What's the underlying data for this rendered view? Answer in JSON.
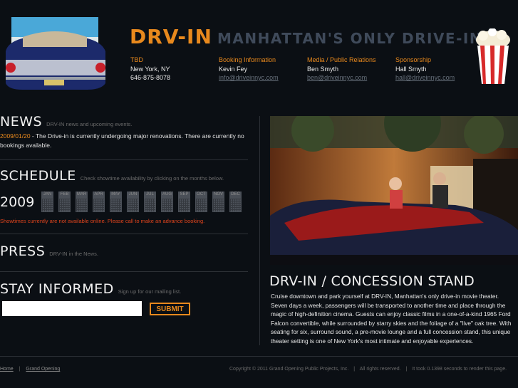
{
  "header": {
    "logo": "DRV-IN",
    "tagline": "MANHATTAN'S ONLY DRIVE-IN",
    "contacts": [
      {
        "label": "TBD",
        "line1": "New York, NY",
        "line2": "646-875-8078"
      },
      {
        "label": "Booking Information",
        "line1": "Kevin Fey",
        "line2": "info@driveinnyc.com"
      },
      {
        "label": "Media / Public Relations",
        "line1": "Ben Smyth",
        "line2": "ben@driveinnyc.com"
      },
      {
        "label": "Sponsorship",
        "line1": "Hall Smyth",
        "line2": "hall@driveinnyc.com"
      }
    ]
  },
  "news": {
    "title": "NEWS",
    "subtitle": "DRV-IN news and upcoming events.",
    "date": "2009/01/20",
    "text": " - The Drive-in is currently undergoing major renovations. There are currently no bookings available."
  },
  "schedule": {
    "title": "SCHEDULE",
    "subtitle": "Check showtime availability by clicking on the months below.",
    "year": "2009",
    "months": [
      "JAN",
      "FEB",
      "MAR",
      "APR",
      "MAY",
      "JUN",
      "JUL",
      "AUG",
      "SEP",
      "OCT",
      "NOV",
      "DEC"
    ],
    "notice": "Showtimes currently are not available online. Please call to make an advance booking."
  },
  "press": {
    "title": "PRESS",
    "subtitle": "DRV-IN in the News."
  },
  "stay": {
    "title": "STAY INFORMED",
    "subtitle": "Sign up for our mailing list.",
    "email_value": "",
    "submit_label": "SUBMIT"
  },
  "feature": {
    "title": "DRV-IN / CONCESSION STAND",
    "text": "Cruise downtown and park yourself at DRV-IN, Manhattan's only drive-in movie theater. Seven days a week, passengers will be transported to another time and place through the magic of high-definition cinema. Guests can enjoy classic films in a one-of-a-kind 1965 Ford Falcon convertible, while surrounded by starry skies and the foliage of a \"live\" oak tree. With seating for six, surround sound, a pre-movie lounge and a full concession stand, this unique theater setting is one of New York's most intimate and enjoyable experiences."
  },
  "footer": {
    "links": [
      "Home",
      "Grand Opening"
    ],
    "copyright": "Copyright © 2011 Grand Opening Public Projects, Inc.",
    "rights": "All rights reserved.",
    "render_time": "It took 0.1398 seconds to render this page."
  },
  "colors": {
    "accent": "#e8891d",
    "background": "#0b0f14",
    "notice": "#e0441d",
    "tagline": "#3f4a5a"
  }
}
